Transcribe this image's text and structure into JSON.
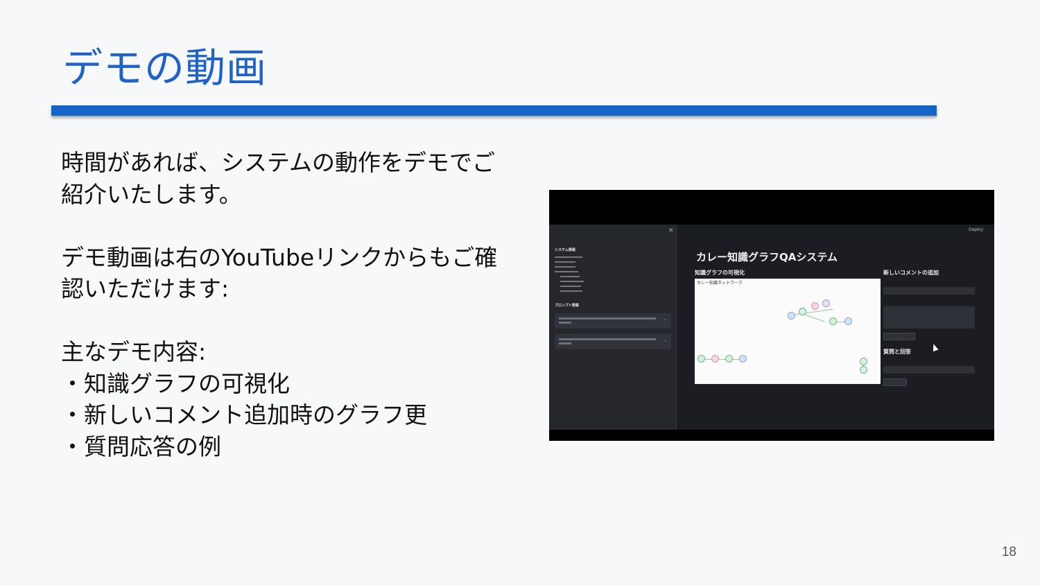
{
  "slide": {
    "title": "デモの動画",
    "paragraph1": "時間があれば、システムの動作をデモでご\n紹介いたします。",
    "paragraph2": "デモ動画は右のYouTubeリンクからもご確\n認いただけます:",
    "contents_heading": "主なデモ内容:",
    "bullets": [
      "・知識グラフの可視化",
      "・新しいコメント追加時のグラフ更",
      "・質問応答の例"
    ],
    "page_number": "18"
  },
  "video": {
    "app_title": "カレー知識グラフQAシステム",
    "graph_heading": "知識グラフの可視化",
    "graph_caption": "カレー知識ネットワーク",
    "add_comment_heading": "新しいコメントの追加",
    "qa_heading": "質問と回答",
    "deploy_label": "Deploy",
    "sidebar_heading1": "システム情報",
    "sidebar_heading2": "プロンプト情報"
  },
  "colors": {
    "accent": "#1f63c8",
    "rule": "#1565c8",
    "background": "#f7f8fa"
  }
}
